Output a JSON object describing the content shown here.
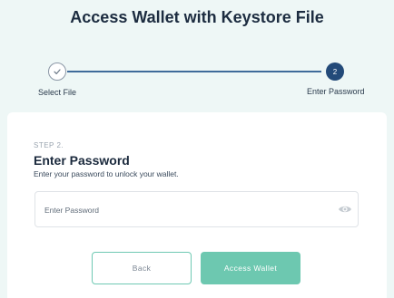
{
  "page": {
    "title": "Access Wallet with Keystore File"
  },
  "stepper": {
    "steps": [
      {
        "label": "Select File",
        "state": "completed",
        "icon": "checkmark-icon"
      },
      {
        "label": "Enter Password",
        "number": "2",
        "state": "active"
      }
    ]
  },
  "form": {
    "step_tag": "STEP 2.",
    "heading": "Enter Password",
    "description": "Enter your password to unlock your wallet.",
    "password_placeholder": "Enter Password",
    "password_value": "",
    "toggle_icon": "eye-icon"
  },
  "actions": {
    "back_label": "Back",
    "access_label": "Access Wallet"
  },
  "colors": {
    "background": "#eef7f6",
    "accent": "#6dc8b0",
    "active_step": "#234a79",
    "progress_line": "#3f6b9a"
  }
}
